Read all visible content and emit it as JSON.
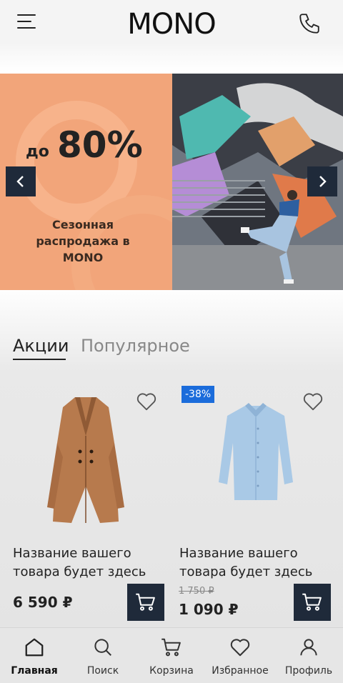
{
  "header": {
    "logo": "MONO",
    "menu_icon": "hamburger-icon",
    "phone_icon": "phone-icon"
  },
  "banner": {
    "promo_prefix": "до",
    "promo_value": "80%",
    "promo_text": "Сезонная распродажа в MONO",
    "prev_icon": "chevron-left-icon",
    "next_icon": "chevron-right-icon"
  },
  "tabs": [
    {
      "label": "Акции",
      "active": true
    },
    {
      "label": "Популярное",
      "active": false
    }
  ],
  "products": [
    {
      "title": "Название вашего товара будет здесь",
      "price": "6 590 ₽",
      "old_price": "",
      "badge": "",
      "image_icon": "coat-image"
    },
    {
      "title": "Название вашего товара будет здесь",
      "price": "1 090 ₽",
      "old_price": "1 750 ₽",
      "badge": "-38%",
      "image_icon": "shirt-image"
    }
  ],
  "bottom_nav": [
    {
      "label": "Главная",
      "icon": "home-icon",
      "active": true
    },
    {
      "label": "Поиск",
      "icon": "search-icon",
      "active": false
    },
    {
      "label": "Корзина",
      "icon": "cart-icon",
      "active": false
    },
    {
      "label": "Избранное",
      "icon": "heart-icon",
      "active": false
    },
    {
      "label": "Профиль",
      "icon": "user-icon",
      "active": false
    }
  ],
  "colors": {
    "accent_dark": "#1f2a3a",
    "badge_blue": "#1b6cdb",
    "promo_orange": "#f2a57a"
  }
}
